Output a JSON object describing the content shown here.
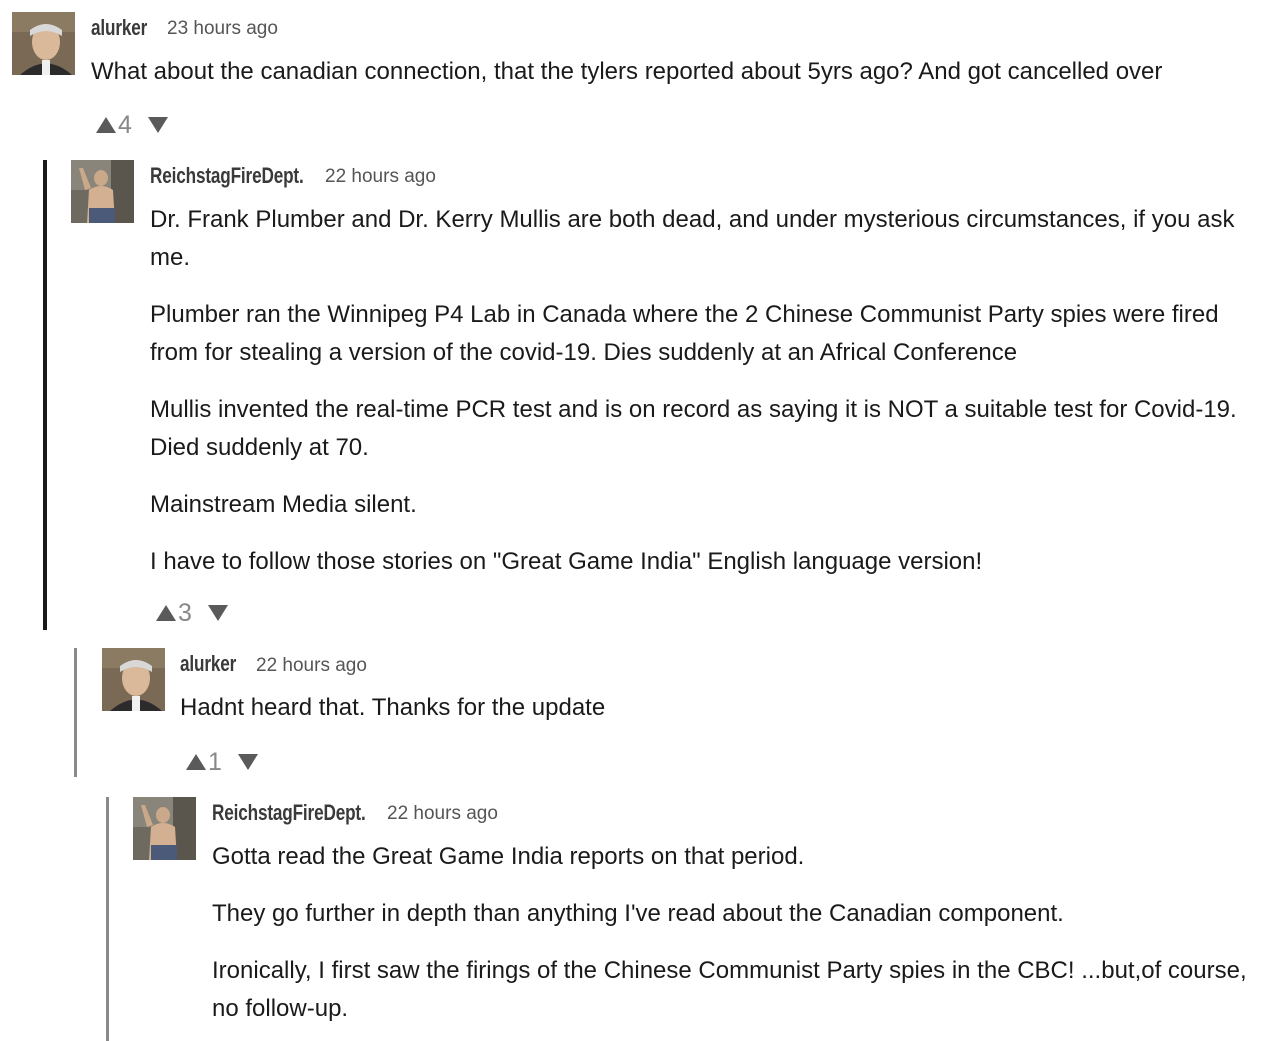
{
  "comments": [
    {
      "username": "alurker",
      "time": "23 hours ago",
      "paragraphs": [
        "What about the canadian connection, that the tylers reported about 5yrs ago? And got cancelled over"
      ],
      "votes": "4"
    },
    {
      "username": "ReichstagFireDept.",
      "time": "22 hours ago",
      "paragraphs": [
        "Dr. Frank Plumber and Dr. Kerry Mullis are both dead, and under mysterious circumstances, if you ask me.",
        "Plumber ran the Winnipeg P4 Lab in Canada where the 2 Chinese Communist Party spies were fired from for stealing a version of the covid-19. Dies suddenly at an Africal Conference",
        "Mullis invented the real-time PCR test and is on record as saying it is NOT a suitable test for Covid-19. Died suddenly at 70.",
        "Mainstream Media silent.",
        "I have to follow those stories on \"Great Game India\" English language version!"
      ],
      "votes": "3"
    },
    {
      "username": "alurker",
      "time": "22 hours ago",
      "paragraphs": [
        "Hadnt heard that. Thanks for the update"
      ],
      "votes": "1"
    },
    {
      "username": "ReichstagFireDept.",
      "time": "22 hours ago",
      "paragraphs": [
        "Gotta read the Great Game India reports on that period.",
        "They go further in depth than anything I've read about the Canadian component.",
        "Ironically, I first saw the firings of the Chinese Communist Party spies in the CBC! ...but,of course, no follow-up."
      ]
    }
  ],
  "colors": {
    "thread_line_active": "#1a1a1a",
    "thread_line": "#8a8a8a",
    "vote_arrow": "#5a5a5a"
  }
}
